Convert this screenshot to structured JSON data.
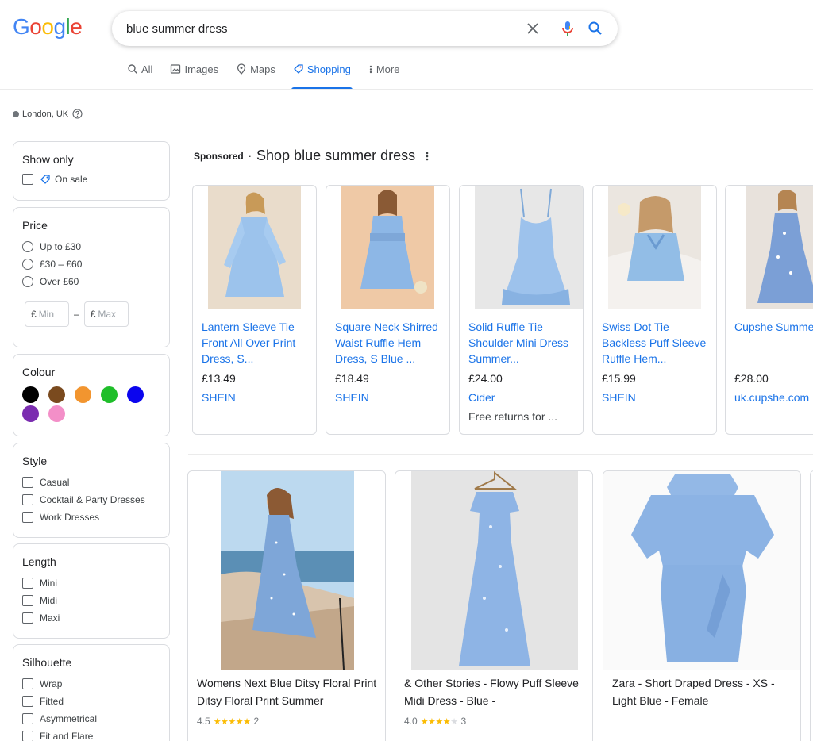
{
  "logo": {
    "letters": [
      "G",
      "o",
      "o",
      "g",
      "l",
      "e"
    ]
  },
  "search": {
    "query": "blue summer dress"
  },
  "tabs": [
    {
      "label": "All",
      "icon": "search-icon"
    },
    {
      "label": "Images",
      "icon": "image-icon"
    },
    {
      "label": "Maps",
      "icon": "map-pin-icon"
    },
    {
      "label": "Shopping",
      "icon": "tag-icon",
      "active": true
    },
    {
      "label": "More",
      "icon": "more-vert-icon"
    }
  ],
  "location": {
    "text": "London, UK"
  },
  "filters": {
    "show_only": {
      "title": "Show only",
      "options": [
        "On sale"
      ]
    },
    "price": {
      "title": "Price",
      "options": [
        "Up to £30",
        "£30 – £60",
        "Over £60"
      ],
      "currency": "£",
      "min_placeholder": "Min",
      "max_placeholder": "Max"
    },
    "colour": {
      "title": "Colour",
      "swatches": [
        "#000000",
        "#7a4a1e",
        "#f2952f",
        "#1fbe2a",
        "#0b05ee",
        "#7b2db0",
        "#f38fc8"
      ]
    },
    "style": {
      "title": "Style",
      "options": [
        "Casual",
        "Cocktail & Party Dresses",
        "Work Dresses"
      ]
    },
    "length": {
      "title": "Length",
      "options": [
        "Mini",
        "Midi",
        "Maxi"
      ]
    },
    "silhouette": {
      "title": "Silhouette",
      "options": [
        "Wrap",
        "Fitted",
        "Asymmetrical",
        "Fit and Flare"
      ]
    }
  },
  "sponsored": {
    "label": "Sponsored",
    "separator": "·",
    "title": "Shop blue summer dress",
    "products": [
      {
        "title": "Lantern Sleeve Tie Front All Over Print Dress, S...",
        "price": "£13.49",
        "merchant": "SHEIN",
        "extra": ""
      },
      {
        "title": "Square Neck Shirred Waist Ruffle Hem Dress, S Blue ...",
        "price": "£18.49",
        "merchant": "SHEIN",
        "extra": ""
      },
      {
        "title": "Solid Ruffle Tie Shoulder Mini Dress Summer...",
        "price": "£24.00",
        "merchant": "Cider",
        "extra": "Free returns for ..."
      },
      {
        "title": "Swiss Dot Tie Backless Puff Sleeve Ruffle Hem...",
        "price": "£15.99",
        "merchant": "SHEIN",
        "extra": ""
      },
      {
        "title": "Cupshe Summer Passion Ditsy Floral Wrap Maxi Party",
        "price": "£28.00",
        "merchant": "uk.cupshe.com",
        "extra": ""
      }
    ]
  },
  "results": [
    {
      "title": "Womens Next Blue Ditsy Floral Print Ditsy Floral Print Summer",
      "rating": "4.5",
      "stars": 4.5,
      "reviews": "2"
    },
    {
      "title": "& Other Stories - Flowy Puff Sleeve Midi Dress - Blue -",
      "rating": "4.0",
      "stars": 4,
      "reviews": "3"
    },
    {
      "title": "Zara - Short Draped Dress - XS - Light Blue - Female",
      "rating": "",
      "stars": 0,
      "reviews": ""
    }
  ],
  "colors": {
    "accent": "#1a73e8",
    "dress_blue": "#8fb6e4",
    "star": "#fbbc04"
  }
}
